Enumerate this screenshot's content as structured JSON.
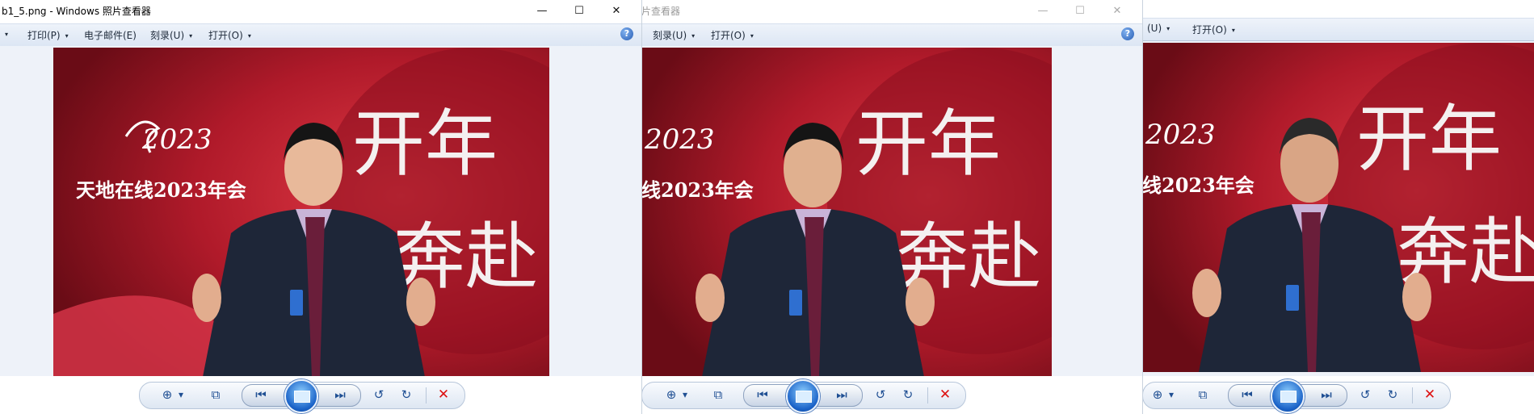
{
  "windows": [
    {
      "title": "b1_5.png - Windows 照片查看器",
      "menu": [
        "打印(P)",
        "电子邮件(E)",
        "刻录(U)",
        "打开(O)"
      ],
      "help": "?"
    },
    {
      "title": "片查看器",
      "menu": [
        "刻录(U)",
        "打开(O)"
      ],
      "help": "?"
    },
    {
      "menu": [
        "(U)",
        "打开(O)"
      ]
    }
  ],
  "photo_text": {
    "logo": "2023",
    "event": "天地在线2023年会",
    "event_cropped": "线2023年会",
    "calligraphy_1": "开年",
    "calligraphy_2": "奔赴"
  },
  "controls": {
    "minimize": "—",
    "maximize": "☐",
    "close": "✕",
    "zoom": "⊕",
    "zoom_caret": "▾",
    "actual_size": "⧉",
    "previous": "⏮",
    "next": "⏭",
    "rotate_ccw": "↺",
    "rotate_cw": "↻",
    "delete": "✕"
  },
  "colors": {
    "menubar": "#dce6f4",
    "backdrop_red": "#b01a2a",
    "accent_blue": "#1f4f93"
  }
}
